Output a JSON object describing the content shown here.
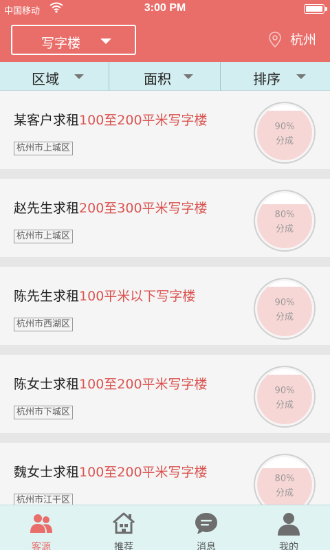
{
  "status_bar": {
    "carrier": "中国移动",
    "time": "3:00 PM"
  },
  "header": {
    "category": "写字楼",
    "city": "杭州"
  },
  "filters": [
    {
      "label": "区域"
    },
    {
      "label": "面积"
    },
    {
      "label": "排序"
    }
  ],
  "listings": [
    {
      "name": "某客户求租",
      "detail": "100至200平米写字楼",
      "district": "杭州市上城区",
      "rate_label": "90%",
      "rate": 0.9,
      "caption": "分成"
    },
    {
      "name": "赵先生求租",
      "detail": "200至300平米写字楼",
      "district": "杭州市上城区",
      "rate_label": "80%",
      "rate": 0.8,
      "caption": "分成"
    },
    {
      "name": "陈先生求租",
      "detail": "100平米以下写字楼",
      "district": "杭州市西湖区",
      "rate_label": "90%",
      "rate": 0.9,
      "caption": "分成"
    },
    {
      "name": "陈女士求租",
      "detail": "100至200平米写字楼",
      "district": "杭州市下城区",
      "rate_label": "90%",
      "rate": 0.9,
      "caption": "分成"
    },
    {
      "name": "魏女士求租",
      "detail": "100至200平米写字楼",
      "district": "杭州市江干区",
      "rate_label": "80%",
      "rate": 0.8,
      "caption": "分成"
    }
  ],
  "tabs": [
    {
      "label": "客源",
      "icon": "customers-icon",
      "active": true
    },
    {
      "label": "推荐",
      "icon": "house-icon",
      "active": false
    },
    {
      "label": "消息",
      "icon": "message-icon",
      "active": false
    },
    {
      "label": "我的",
      "icon": "profile-icon",
      "active": false
    }
  ],
  "colors": {
    "brand": "#e96d69",
    "highlight": "#d9534f",
    "filter_bg": "#d3eef0",
    "ring_fill": "#f7d7d6"
  }
}
